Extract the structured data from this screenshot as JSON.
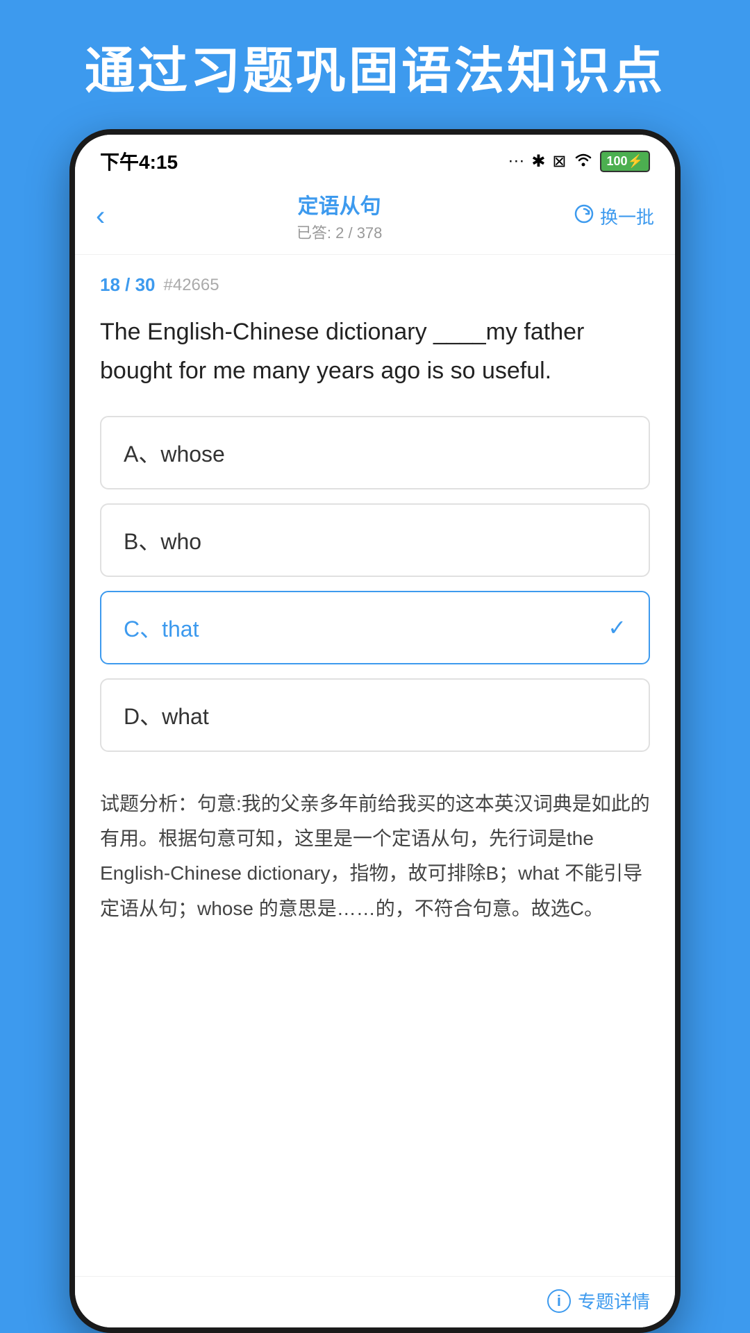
{
  "page": {
    "bg_color": "#3d9aee",
    "header_title": "通过习题巩固语法知识点"
  },
  "status_bar": {
    "time": "下午4:15",
    "dots": "···",
    "bluetooth": "✱",
    "sim": "▣",
    "wifi": "WiFi",
    "battery": "100"
  },
  "nav": {
    "back_label": "‹",
    "title": "定语从句",
    "subtitle": "已答: 2 / 378",
    "action_label": "换一批"
  },
  "question": {
    "progress": "18 / 30",
    "id": "#42665",
    "text": "The English-Chinese dictionary ____my father bought for me many years ago is so useful."
  },
  "options": [
    {
      "id": "A",
      "label": "A、whose",
      "selected": false
    },
    {
      "id": "B",
      "label": "B、who",
      "selected": false
    },
    {
      "id": "C",
      "label": "C、that",
      "selected": true
    },
    {
      "id": "D",
      "label": "D、what",
      "selected": false
    }
  ],
  "analysis": {
    "label": "试题分析：",
    "text": "试题分析：句意:我的父亲多年前给我买的这本英汉词典是如此的有用。根据句意可知，这里是一个定语从句，先行词是the English-Chinese dictionary，指物，故可排除B；what 不能引导定语从句；whose 的意思是……的，不符合句意。故选C。"
  },
  "bottom": {
    "detail_btn_label": "专题详情",
    "info_icon": "i"
  }
}
